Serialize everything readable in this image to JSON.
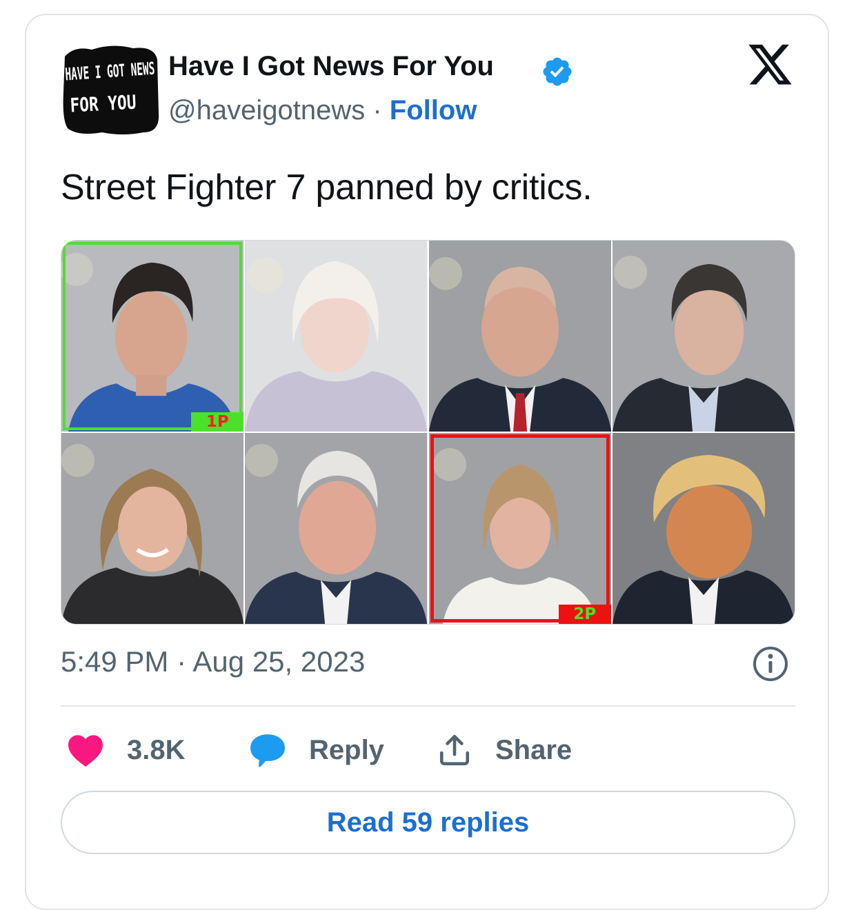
{
  "author": {
    "name": "Have I Got News For You",
    "handle": "@haveigotnews",
    "separator": "·",
    "follow_label": "Follow",
    "avatar_text_line1": "HAVE I GOT NEWS",
    "avatar_text_line2": "FOR YOU"
  },
  "tweet": {
    "text": "Street Fighter 7 panned by critics.",
    "timestamp": "5:49 PM · Aug 25, 2023"
  },
  "media": {
    "player1_label": "1P",
    "player2_label": "2P"
  },
  "actions": {
    "likes": "3.8K",
    "reply_label": "Reply",
    "share_label": "Share"
  },
  "read_replies_label": "Read 59 replies",
  "icons": [
    "verified-badge-icon",
    "x-logo-icon",
    "info-icon",
    "heart-icon",
    "reply-bubble-icon",
    "share-icon"
  ],
  "colors": {
    "link_blue": "#1d6fd0",
    "verified_blue": "#1d9bf0",
    "heart_pink": "#f91880",
    "player1_green": "#4be12a",
    "player2_red": "#ee1111"
  }
}
